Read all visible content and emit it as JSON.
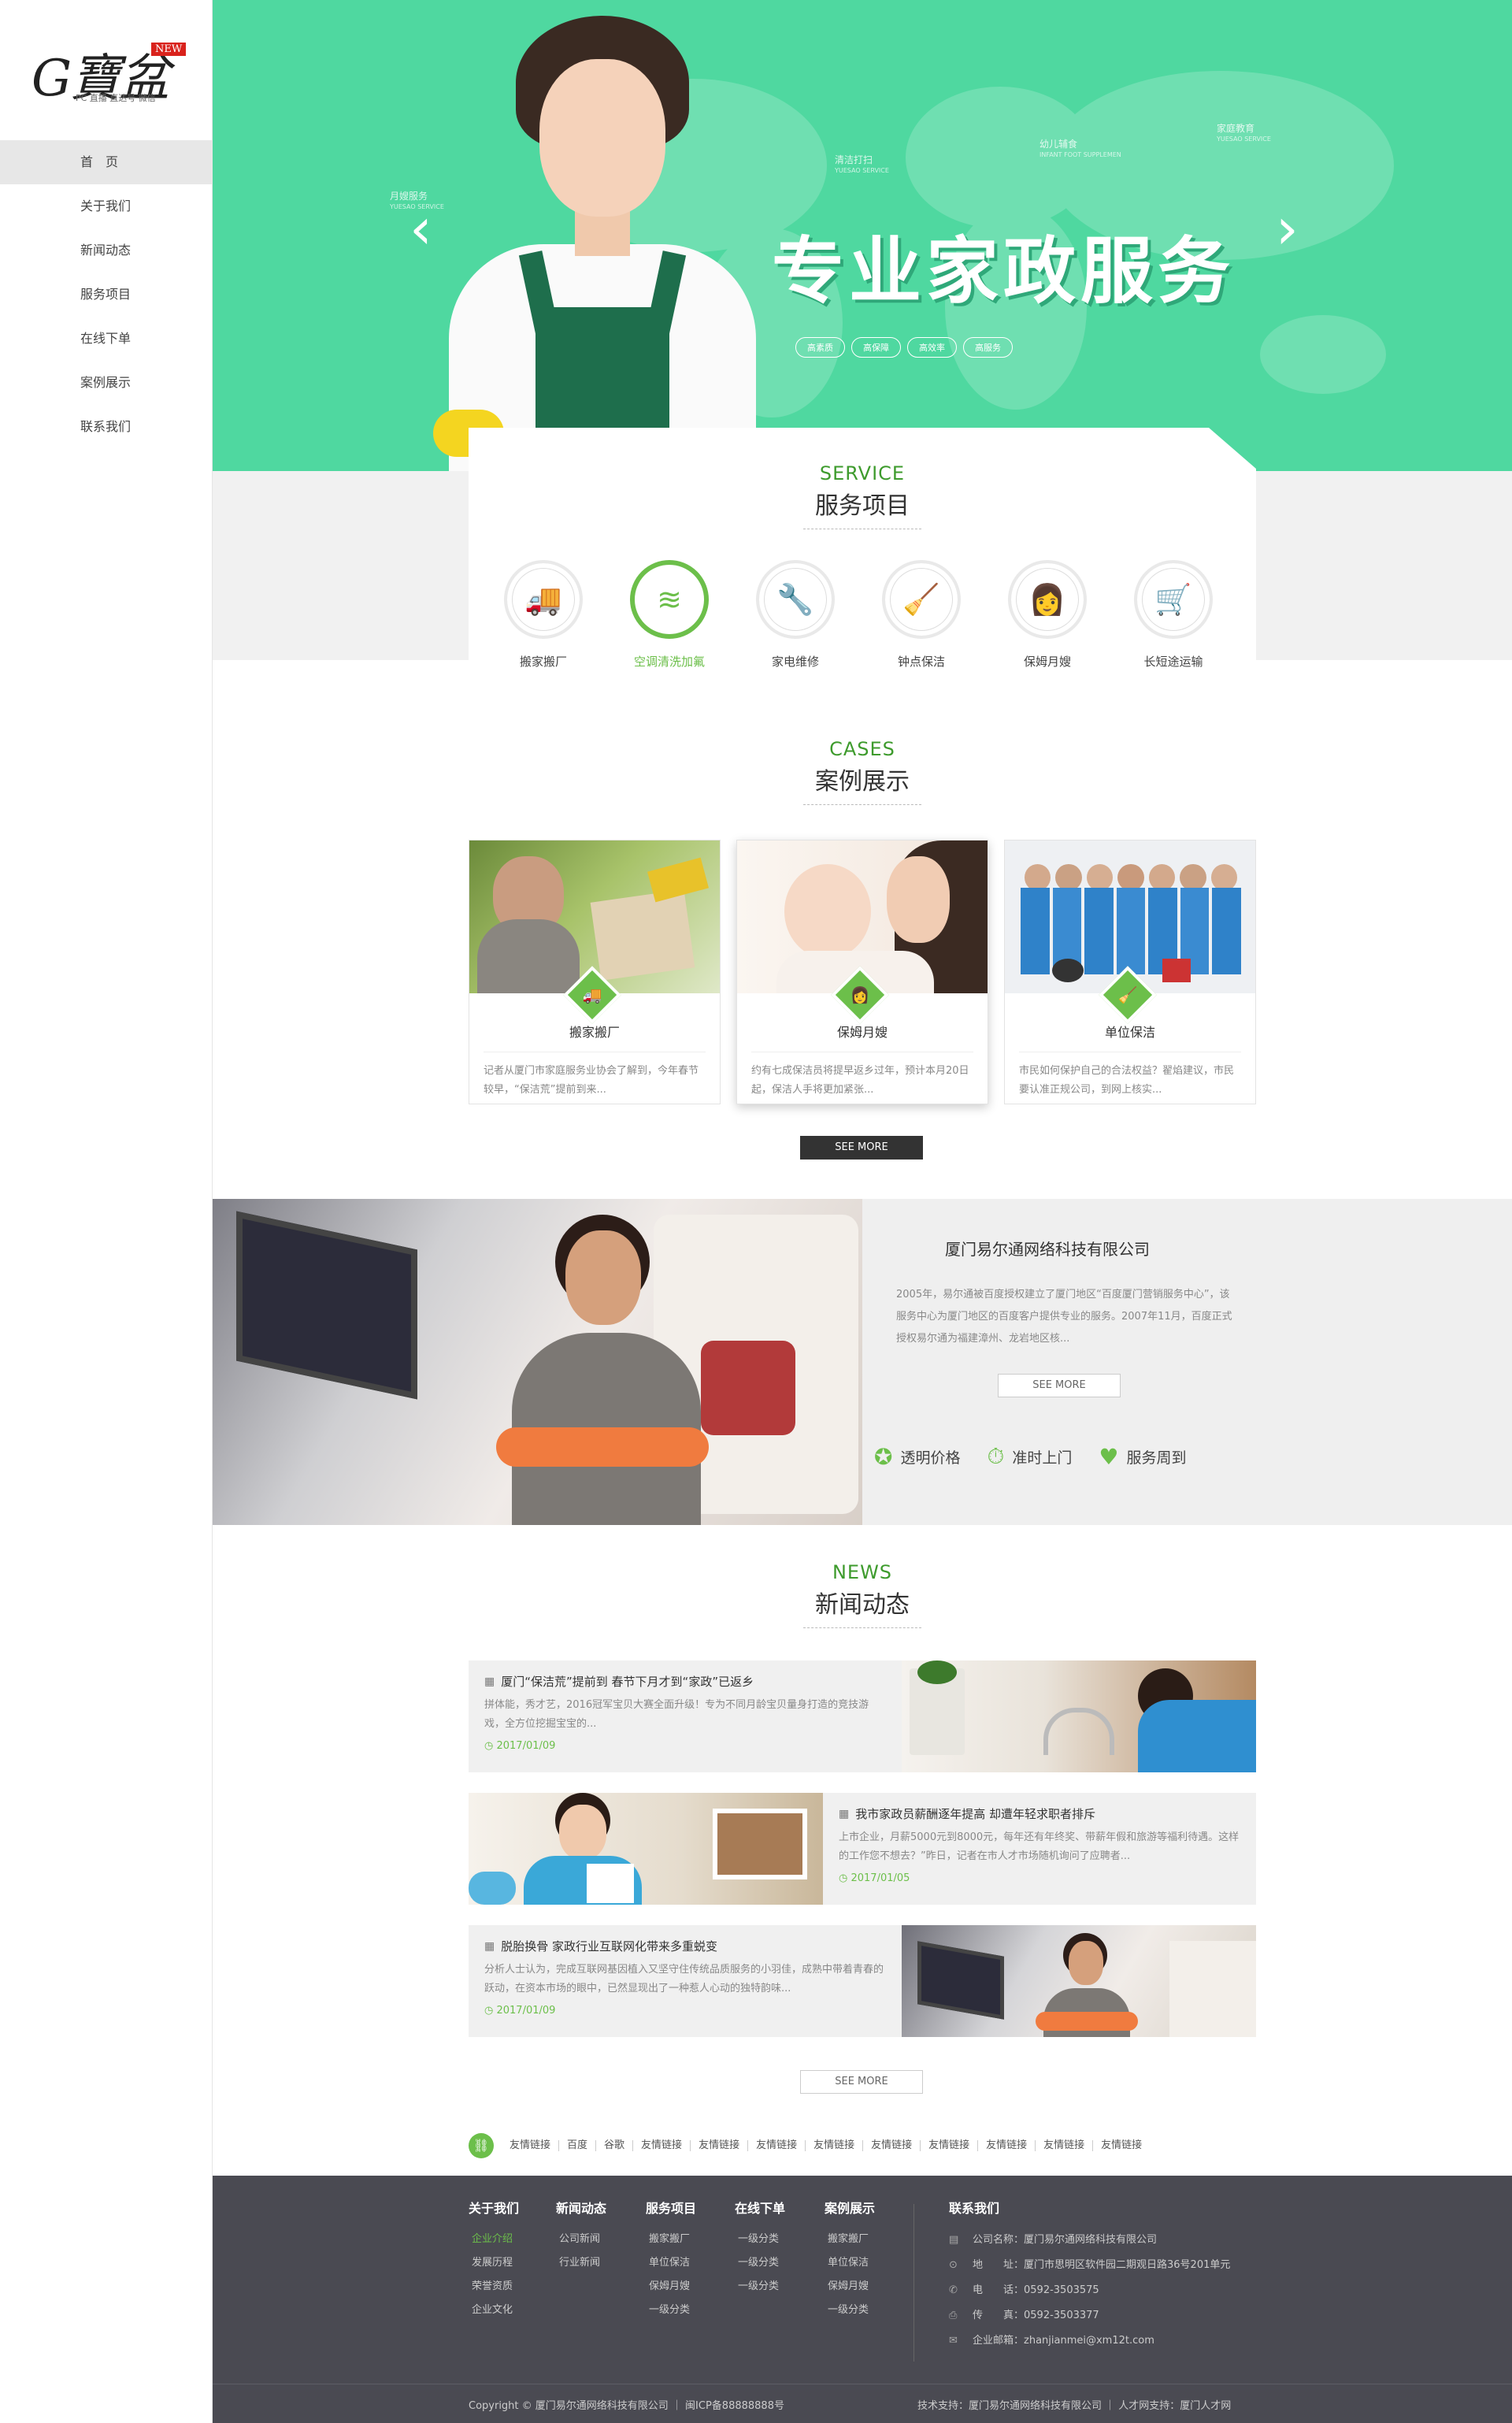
{
  "sidebar": {
    "logo_text": "G寶盆",
    "logo_badge": "NEW",
    "logo_sub": "PC  直播  直达号  微信",
    "items": [
      {
        "label": "首　页"
      },
      {
        "label": "关于我们"
      },
      {
        "label": "新闻动态"
      },
      {
        "label": "服务项目"
      },
      {
        "label": "在线下单"
      },
      {
        "label": "案例展示"
      },
      {
        "label": "联系我们"
      }
    ]
  },
  "banner": {
    "headline": "专业家政服务",
    "prev_arrow": "‹",
    "next_arrow": "›",
    "tags": [
      "高素质",
      "高保障",
      "高效率",
      "高服务"
    ],
    "floating": [
      {
        "cn": "月嫂服务",
        "en": "YUESAO SERVICE"
      },
      {
        "cn": "清洁打扫",
        "en": "YUESAO SERVICE"
      },
      {
        "cn": "幼儿辅食",
        "en": "INFANT FOOT SUPPLEMEN"
      },
      {
        "cn": "家庭教育",
        "en": "YUESAO SERVICE"
      }
    ]
  },
  "services": {
    "en": "SERVICE",
    "cn": "服务项目",
    "items": [
      {
        "label": "搬家搬厂",
        "icon": "truck-icon",
        "glyph": "🚚"
      },
      {
        "label": "空调清洗加氟",
        "icon": "air-conditioner-icon",
        "glyph": "≋"
      },
      {
        "label": "家电维修",
        "icon": "repair-icon",
        "glyph": "🔧"
      },
      {
        "label": "钟点保洁",
        "icon": "broom-icon",
        "glyph": "🧹"
      },
      {
        "label": "保姆月嫂",
        "icon": "nanny-icon",
        "glyph": "👩"
      },
      {
        "label": "长短途运输",
        "icon": "cart-icon",
        "glyph": "🛒"
      }
    ]
  },
  "cases": {
    "en": "CASES",
    "cn": "案例展示",
    "items": [
      {
        "name": "搬家搬厂",
        "desc": "记者从厦门市家庭服务业协会了解到，今年春节较早，“保洁荒”提前到来...",
        "badge_glyph": "🚚"
      },
      {
        "name": "保姆月嫂",
        "desc": "约有七成保洁员将提早返乡过年，预计本月20日起，保洁人手将更加紧张...",
        "badge_glyph": "👩"
      },
      {
        "name": "单位保洁",
        "desc": "市民如何保护自己的合法权益？翟焰建议，市民要认准正规公司，到网上核实...",
        "badge_glyph": "🧹"
      }
    ],
    "more": "SEE MORE"
  },
  "company": {
    "name": "厦门易尔通网络科技有限公司",
    "desc": "2005年，易尔通被百度授权建立了厦门地区“百度厦门营销服务中心”，该服务中心为厦门地区的百度客户提供专业的服务。2007年11月，百度正式授权易尔通为福建漳州、龙岩地区核...",
    "more": "SEE MORE",
    "features": [
      {
        "label": "透明价格",
        "icon": "price-icon",
        "glyph": "✪"
      },
      {
        "label": "准时上门",
        "icon": "clock-icon",
        "glyph": "⏱"
      },
      {
        "label": "服务周到",
        "icon": "handshake-icon",
        "glyph": "♥"
      }
    ]
  },
  "news": {
    "en": "NEWS",
    "cn": "新闻动态",
    "items": [
      {
        "title": "厦门“保洁荒”提前到 春节下月才到“家政”已返乡",
        "body": "拼体能，秀才艺，2016冠军宝贝大赛全面升级！专为不同月龄宝贝量身打造的竞技游戏，全方位挖掘宝宝的...",
        "date": "2017/01/09"
      },
      {
        "title": "我市家政员薪酬逐年提高 却遭年轻求职者排斥",
        "body": "上市企业，月薪5000元到8000元，每年还有年终奖、带薪年假和旅游等福利待遇。这样的工作您不想去？”昨日，记者在市人才市场随机询问了应聘者...",
        "date": "2017/01/05"
      },
      {
        "title": "脱胎换骨 家政行业互联网化带来多重蜕变",
        "body": "分析人士认为，完成互联网基因植入又坚守住传统品质服务的小羽佳，成熟中带着青春的跃动，在资本市场的眼中，已然显现出了一种惹人心动的独特韵味...",
        "date": "2017/01/09"
      }
    ],
    "more": "SEE MORE"
  },
  "friends": {
    "links": [
      "友情链接",
      "百度",
      "谷歌",
      "友情链接",
      "友情链接",
      "友情链接",
      "友情链接",
      "友情链接",
      "友情链接",
      "友情链接",
      "友情链接",
      "友情链接"
    ]
  },
  "footer": {
    "columns": [
      {
        "title": "关于我们",
        "links": [
          "企业介绍",
          "发展历程",
          "荣誉资质",
          "企业文化"
        ]
      },
      {
        "title": "新闻动态",
        "links": [
          "公司新闻",
          "行业新闻"
        ]
      },
      {
        "title": "服务项目",
        "links": [
          "搬家搬厂",
          "单位保洁",
          "保姆月嫂",
          "一级分类"
        ]
      },
      {
        "title": "在线下单",
        "links": [
          "一级分类",
          "一级分类",
          "一级分类"
        ]
      },
      {
        "title": "案例展示",
        "links": [
          "搬家搬厂",
          "单位保洁",
          "保姆月嫂",
          "一级分类"
        ]
      }
    ],
    "contact": {
      "title": "联系我们",
      "rows": [
        {
          "icon": "building-icon",
          "glyph": "▤",
          "text": "公司名称：厦门易尔通网络科技有限公司"
        },
        {
          "icon": "location-icon",
          "glyph": "⊙",
          "text": "地　　址：厦门市思明区软件园二期观日路36号201单元"
        },
        {
          "icon": "phone-icon",
          "glyph": "✆",
          "text": "电　　话：0592-3503575"
        },
        {
          "icon": "fax-icon",
          "glyph": "⎙",
          "text": "传　　真：0592-3503377"
        },
        {
          "icon": "mail-icon",
          "glyph": "✉",
          "text": "企业邮箱：zhanjianmei@xm12t.com"
        }
      ]
    },
    "copyright": "Copyright © 厦门易尔通网络科技有限公司 ｜ 闽ICP备88888888号",
    "support": "技术支持：厦门易尔通网络科技有限公司 ｜ 人才网支持：厦门人才网"
  },
  "colors": {
    "accent": "#6cbf4a",
    "banner": "#4fd8a0",
    "footer": "#4a4a52"
  }
}
